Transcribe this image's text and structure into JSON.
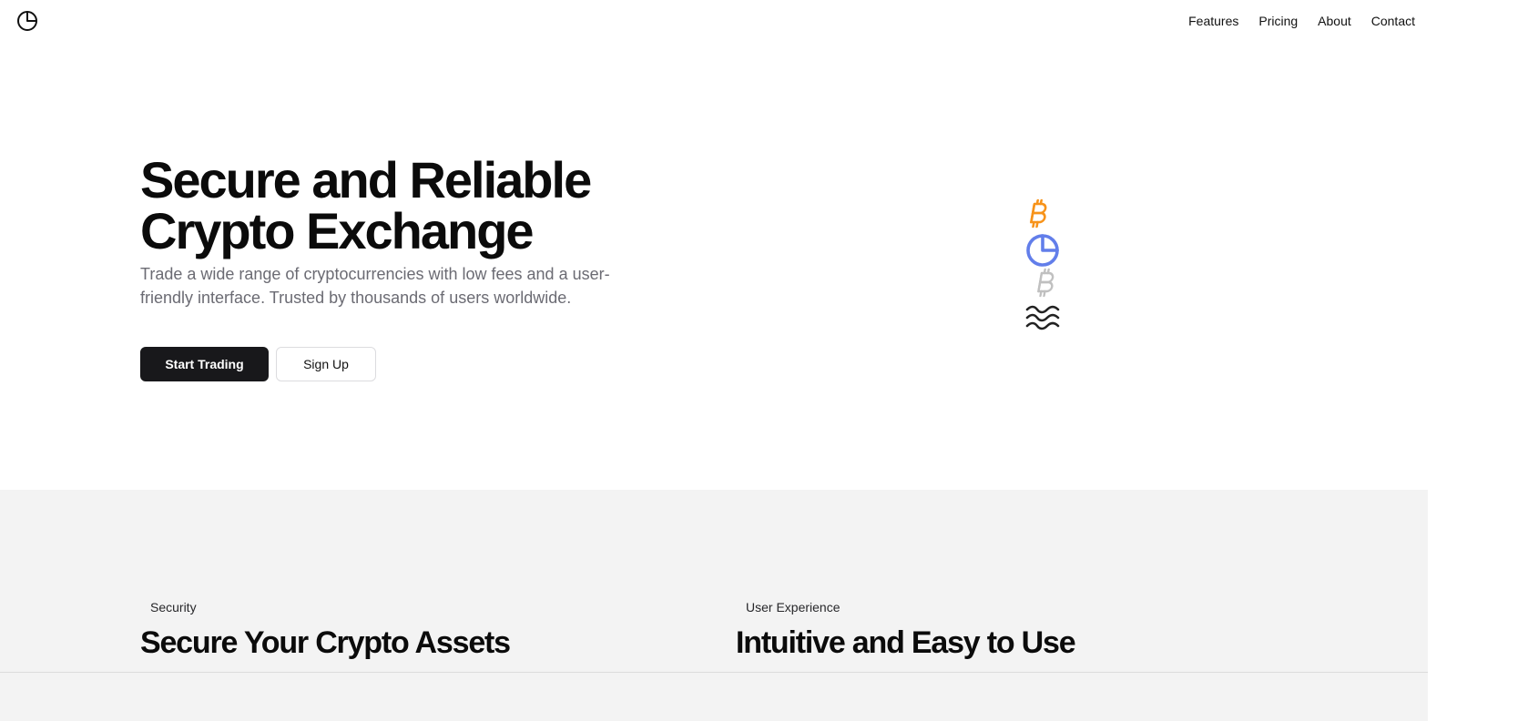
{
  "header": {
    "logo_icon": "pie-clock-icon",
    "nav": [
      "Features",
      "Pricing",
      "About",
      "Contact"
    ]
  },
  "hero": {
    "title_line1": "Secure and Reliable",
    "title_line2": "Crypto Exchange",
    "subtitle": "Trade a wide range of cryptocurrencies with low fees and a user-friendly interface. Trusted by thousands of users worldwide.",
    "primary_button": "Start Trading",
    "secondary_button": "Sign Up",
    "icons": [
      {
        "name": "bitcoin-icon",
        "color": "#f7931a"
      },
      {
        "name": "pie-chart-icon",
        "color": "#627eea"
      },
      {
        "name": "bitcoin-outline-icon",
        "color": "#c0c0c0"
      },
      {
        "name": "waves-icon",
        "color": "#222222"
      }
    ]
  },
  "features": [
    {
      "label": "Security",
      "title": "Secure Your Crypto Assets"
    },
    {
      "label": "User Experience",
      "title": "Intuitive and Easy to Use"
    }
  ],
  "colors": {
    "primary_button_bg": "#18181b",
    "band_bg": "#f3f3f3",
    "subtitle_text": "#6b6b73"
  }
}
